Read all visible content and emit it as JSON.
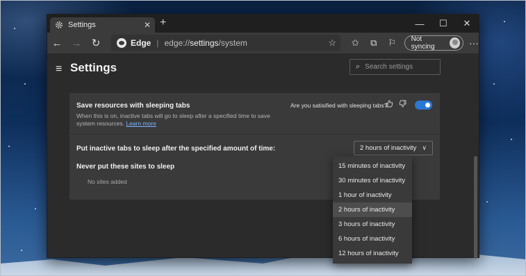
{
  "tab": {
    "title": "Settings",
    "close": "✕",
    "new_tab": "+"
  },
  "window_controls": {
    "minimize": "—",
    "maximize": "☐",
    "close": "✕"
  },
  "toolbar": {
    "back": "←",
    "forward": "→",
    "refresh": "↻",
    "brand": "Edge",
    "url_prefix": "edge://",
    "url_bold": "settings",
    "url_suffix": "/system",
    "sync_label": "Not syncing",
    "more": "···"
  },
  "settings": {
    "title": "Settings",
    "search_placeholder": "Search settings"
  },
  "sleeping_tabs": {
    "title": "Save resources with sleeping tabs",
    "description": "When this is on, inactive tabs will go to sleep after a specified time to save system resources.",
    "learn_more": "Learn more",
    "feedback_question": "Are you satisified with sleeping tabs?",
    "enabled": true
  },
  "timeout": {
    "label": "Put inactive tabs to sleep after the specified amount of time:",
    "selected": "2 hours of inactivity",
    "options": [
      "15 minutes of inactivity",
      "30 minutes of inactivity",
      "1 hour of inactivity",
      "2 hours of inactivity",
      "3 hours of inactivity",
      "6 hours of inactivity",
      "12 hours of inactivity"
    ],
    "highlighted_index": 3
  },
  "never_sleep": {
    "label": "Never put these sites to sleep",
    "empty_text": "No sites added"
  }
}
